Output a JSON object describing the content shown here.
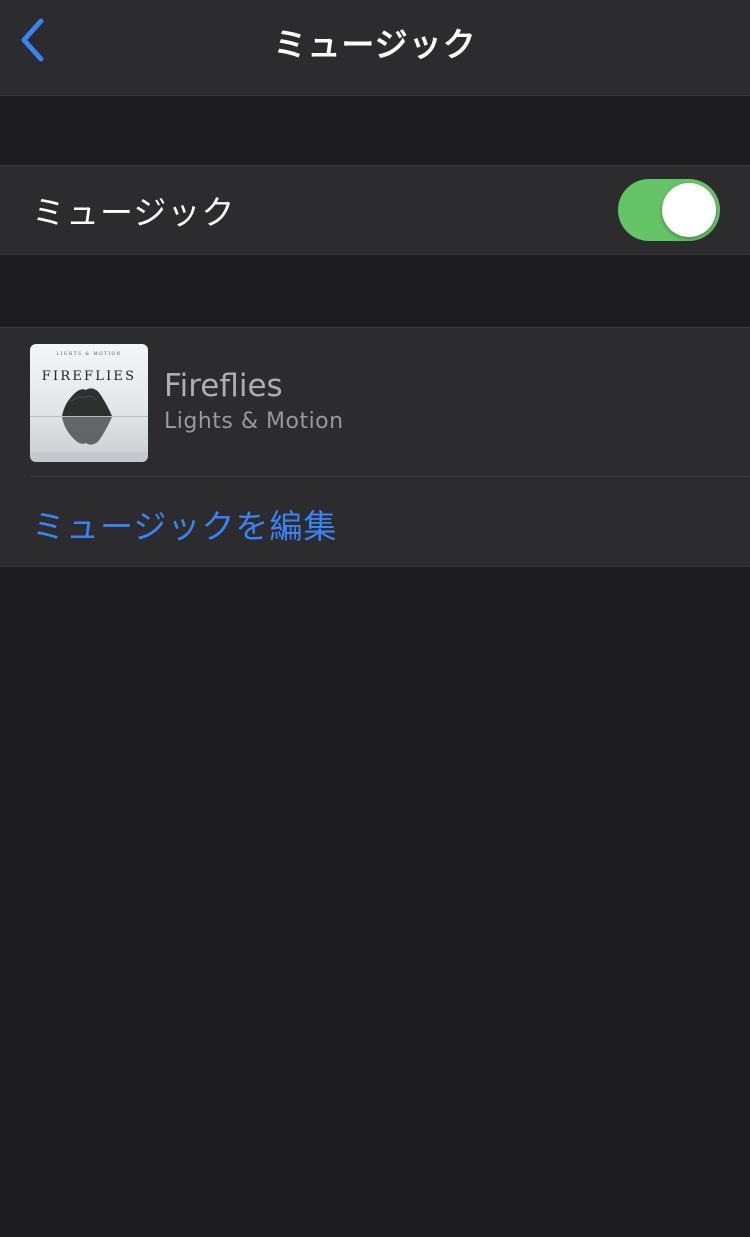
{
  "nav": {
    "title": "ミュージック",
    "back_icon": "chevron-left-icon"
  },
  "music_toggle": {
    "label": "ミュージック",
    "state": "on",
    "on_color": "#65c466"
  },
  "track": {
    "title": "Fireflies",
    "artist": "Lights & Motion",
    "artwork_title": "FIREFLIES",
    "artwork_subtitle": "LIGHTS & MOTION"
  },
  "edit": {
    "label": "ミュージックを編集",
    "color": "#3a82f7"
  },
  "colors": {
    "background": "#1c1c1e",
    "cell": "#2c2c2e",
    "separator": "#3a3a3c",
    "accent": "#3a82f7"
  }
}
